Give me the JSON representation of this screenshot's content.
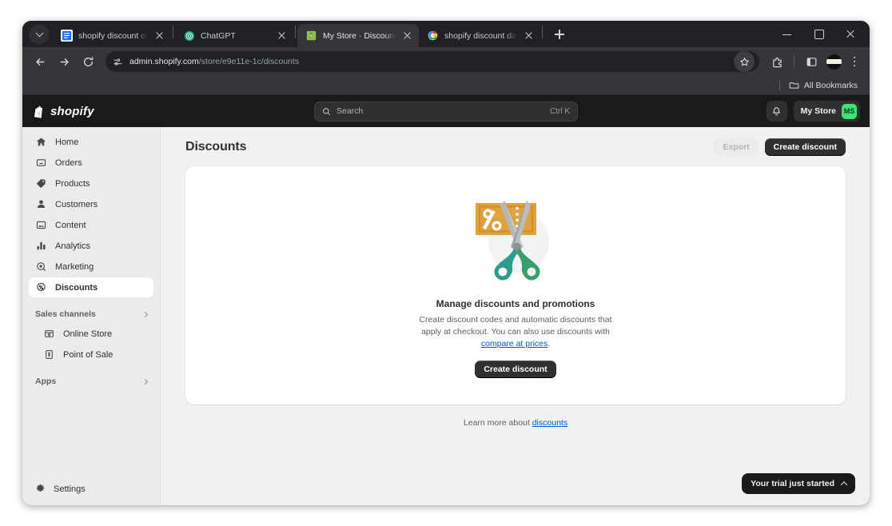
{
  "browser": {
    "tabs": [
      {
        "title": "shopify discount codes - Googl",
        "favicon": "google-docs-icon",
        "active": false
      },
      {
        "title": "ChatGPT",
        "favicon": "chatgpt-icon",
        "active": false
      },
      {
        "title": "My Store · Discounts · Shopify",
        "favicon": "shopify-icon",
        "active": true
      },
      {
        "title": "shopify discount dashboard - G",
        "favicon": "google-icon",
        "active": false
      }
    ],
    "new_tab_label": "New tab",
    "tab_list_label": "Search tabs",
    "window_controls": {
      "minimize": "Minimize",
      "maximize": "Maximize",
      "close": "Close"
    },
    "nav": {
      "back": "Back",
      "forward": "Forward",
      "reload": "Reload"
    },
    "omnibox": {
      "host": "admin.shopify.com",
      "path": "/store/e9e11e-1c/discounts",
      "site_info_label": "View site information",
      "star_label": "Bookmark this tab",
      "extensions_label": "Extensions",
      "split_label": "Side panel",
      "profile_label": "Profile",
      "menu_label": "Customize and control Chrome"
    },
    "bookmarks": {
      "all_bookmarks_label": "All Bookmarks"
    }
  },
  "shopify": {
    "brand": "shopify",
    "search": {
      "placeholder": "Search",
      "shortcut": "Ctrl K"
    },
    "notifications_label": "Notifications",
    "store": {
      "name": "My Store",
      "initials": "MS"
    },
    "sidebar": {
      "items": [
        {
          "label": "Home",
          "icon": "home-icon",
          "active": false
        },
        {
          "label": "Orders",
          "icon": "orders-icon",
          "active": false
        },
        {
          "label": "Products",
          "icon": "products-tag-icon",
          "active": false
        },
        {
          "label": "Customers",
          "icon": "customers-person-icon",
          "active": false
        },
        {
          "label": "Content",
          "icon": "content-icon",
          "active": false
        },
        {
          "label": "Analytics",
          "icon": "analytics-bars-icon",
          "active": false
        },
        {
          "label": "Marketing",
          "icon": "marketing-megaphone-icon",
          "active": false
        },
        {
          "label": "Discounts",
          "icon": "discounts-badge-icon",
          "active": true
        }
      ],
      "sales_channels": {
        "label": "Sales channels",
        "items": [
          {
            "label": "Online Store",
            "icon": "online-store-icon"
          },
          {
            "label": "Point of Sale",
            "icon": "point-of-sale-icon"
          }
        ]
      },
      "apps": {
        "label": "Apps"
      },
      "settings": {
        "label": "Settings",
        "icon": "gear-icon"
      }
    },
    "page": {
      "title": "Discounts",
      "export_label": "Export",
      "create_discount_label": "Create discount",
      "empty_state": {
        "illustration": "discount-scissors-coupon-illustration",
        "title": "Manage discounts and promotions",
        "description_part1": "Create discount codes and automatic discounts that apply at checkout. You can also use discounts with ",
        "description_link": "compare at prices",
        "description_part2": ".",
        "cta_label": "Create discount"
      },
      "learn_more_prefix": "Learn more about ",
      "learn_more_link": "discounts"
    },
    "trial_toast": {
      "label": "Your trial just started"
    }
  },
  "colors": {
    "shopify_dark": "#1a1a1a",
    "accent_green": "#3ee375",
    "link_blue": "#005bd3",
    "page_bg": "#f1f1f1",
    "sidebar_bg": "#ebebeb",
    "illustration_orange": "#e0a140",
    "illustration_teal": "#2e9b8b",
    "illustration_green": "#3a9d6e"
  }
}
